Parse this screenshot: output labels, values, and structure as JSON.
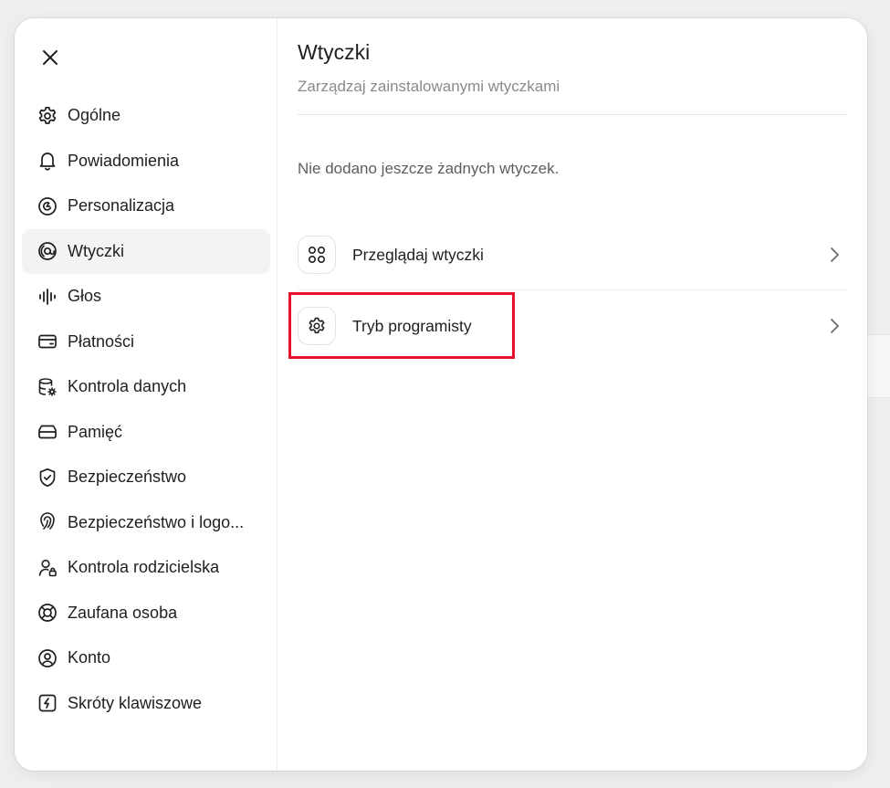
{
  "sidebar": {
    "close_label": "Close",
    "items": [
      {
        "label": "Ogólne",
        "icon": "gear-icon"
      },
      {
        "label": "Powiadomienia",
        "icon": "bell-icon"
      },
      {
        "label": "Personalizacja",
        "icon": "personalize-icon"
      },
      {
        "label": "Wtyczki",
        "icon": "plugin-icon",
        "active": true
      },
      {
        "label": "Głos",
        "icon": "voice-waveform-icon"
      },
      {
        "label": "Płatności",
        "icon": "wallet-icon"
      },
      {
        "label": "Kontrola danych",
        "icon": "database-gear-icon"
      },
      {
        "label": "Pamięć",
        "icon": "memory-icon"
      },
      {
        "label": "Bezpieczeństwo",
        "icon": "shield-check-icon"
      },
      {
        "label": "Bezpieczeństwo i logo...",
        "icon": "fingerprint-icon"
      },
      {
        "label": "Kontrola rodzicielska",
        "icon": "user-lock-icon"
      },
      {
        "label": "Zaufana osoba",
        "icon": "lifebuoy-icon"
      },
      {
        "label": "Konto",
        "icon": "account-circle-icon"
      },
      {
        "label": "Skróty klawiszowe",
        "icon": "keyboard-shortcut-icon"
      }
    ]
  },
  "main": {
    "title": "Wtyczki",
    "subtitle": "Zarządzaj zainstalowanymi wtyczkami",
    "empty_text": "Nie dodano jeszcze żadnych wtyczek.",
    "rows": [
      {
        "label": "Przeglądaj wtyczki",
        "icon": "grid-circles-icon"
      },
      {
        "label": "Tryb programisty",
        "icon": "gear-icon"
      }
    ]
  },
  "colors": {
    "highlight": "#e8112d",
    "active_bg": "#f3f3f3",
    "subtitle": "#8a8a8a"
  }
}
